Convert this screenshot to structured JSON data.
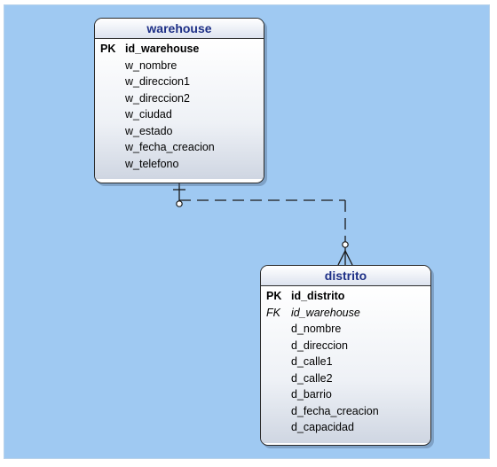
{
  "entities": {
    "warehouse": {
      "title": "warehouse",
      "pk_marker": "PK",
      "pk_field": "id_warehouse",
      "fields": [
        "w_nombre",
        "w_direccion1",
        "w_direccion2",
        "w_ciudad",
        "w_estado",
        "w_fecha_creacion",
        "w_telefono"
      ]
    },
    "distrito": {
      "title": "distrito",
      "pk_marker": "PK",
      "pk_field": "id_distrito",
      "fk_marker": "FK",
      "fk_field": "id_warehouse",
      "fields": [
        "d_nombre",
        "d_direccion",
        "d_calle1",
        "d_calle2",
        "d_barrio",
        "d_fecha_creacion",
        "d_capacidad"
      ]
    }
  },
  "colors": {
    "background": "#9fc9f2",
    "title_text": "#1d2f86",
    "line": "#1a1a1a"
  },
  "relationship": {
    "from": "warehouse",
    "to": "distrito",
    "style": "dashed",
    "cardinality_from": "zero-or-one",
    "cardinality_to": "zero-or-many"
  }
}
